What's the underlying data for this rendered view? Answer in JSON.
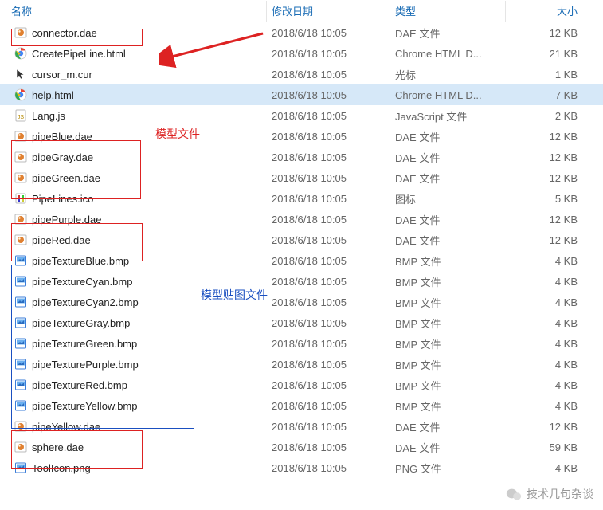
{
  "header": {
    "name": "名称",
    "date": "修改日期",
    "type": "类型",
    "size": "大小"
  },
  "rows": [
    {
      "icon": "dae",
      "name": "connector.dae",
      "date": "2018/6/18 10:05",
      "type": "DAE 文件",
      "size": "12 KB",
      "sel": false
    },
    {
      "icon": "chrome",
      "name": "CreatePipeLine.html",
      "date": "2018/6/18 10:05",
      "type": "Chrome HTML D...",
      "size": "21 KB",
      "sel": false
    },
    {
      "icon": "cur",
      "name": "cursor_m.cur",
      "date": "2018/6/18 10:05",
      "type": "光标",
      "size": "1 KB",
      "sel": false
    },
    {
      "icon": "chrome",
      "name": "help.html",
      "date": "2018/6/18 10:05",
      "type": "Chrome HTML D...",
      "size": "7 KB",
      "sel": true
    },
    {
      "icon": "js",
      "name": "Lang.js",
      "date": "2018/6/18 10:05",
      "type": "JavaScript 文件",
      "size": "2 KB",
      "sel": false
    },
    {
      "icon": "dae",
      "name": "pipeBlue.dae",
      "date": "2018/6/18 10:05",
      "type": "DAE 文件",
      "size": "12 KB",
      "sel": false
    },
    {
      "icon": "dae",
      "name": "pipeGray.dae",
      "date": "2018/6/18 10:05",
      "type": "DAE 文件",
      "size": "12 KB",
      "sel": false
    },
    {
      "icon": "dae",
      "name": "pipeGreen.dae",
      "date": "2018/6/18 10:05",
      "type": "DAE 文件",
      "size": "12 KB",
      "sel": false
    },
    {
      "icon": "ico",
      "name": "PipeLines.ico",
      "date": "2018/6/18 10:05",
      "type": "图标",
      "size": "5 KB",
      "sel": false
    },
    {
      "icon": "dae",
      "name": "pipePurple.dae",
      "date": "2018/6/18 10:05",
      "type": "DAE 文件",
      "size": "12 KB",
      "sel": false
    },
    {
      "icon": "dae",
      "name": "pipeRed.dae",
      "date": "2018/6/18 10:05",
      "type": "DAE 文件",
      "size": "12 KB",
      "sel": false
    },
    {
      "icon": "bmp",
      "name": "pipeTextureBlue.bmp",
      "date": "2018/6/18 10:05",
      "type": "BMP 文件",
      "size": "4 KB",
      "sel": false
    },
    {
      "icon": "bmp",
      "name": "pipeTextureCyan.bmp",
      "date": "2018/6/18 10:05",
      "type": "BMP 文件",
      "size": "4 KB",
      "sel": false
    },
    {
      "icon": "bmp",
      "name": "pipeTextureCyan2.bmp",
      "date": "2018/6/18 10:05",
      "type": "BMP 文件",
      "size": "4 KB",
      "sel": false
    },
    {
      "icon": "bmp",
      "name": "pipeTextureGray.bmp",
      "date": "2018/6/18 10:05",
      "type": "BMP 文件",
      "size": "4 KB",
      "sel": false
    },
    {
      "icon": "bmp",
      "name": "pipeTextureGreen.bmp",
      "date": "2018/6/18 10:05",
      "type": "BMP 文件",
      "size": "4 KB",
      "sel": false
    },
    {
      "icon": "bmp",
      "name": "pipeTexturePurple.bmp",
      "date": "2018/6/18 10:05",
      "type": "BMP 文件",
      "size": "4 KB",
      "sel": false
    },
    {
      "icon": "bmp",
      "name": "pipeTextureRed.bmp",
      "date": "2018/6/18 10:05",
      "type": "BMP 文件",
      "size": "4 KB",
      "sel": false
    },
    {
      "icon": "bmp",
      "name": "pipeTextureYellow.bmp",
      "date": "2018/6/18 10:05",
      "type": "BMP 文件",
      "size": "4 KB",
      "sel": false
    },
    {
      "icon": "dae",
      "name": "pipeYellow.dae",
      "date": "2018/6/18 10:05",
      "type": "DAE 文件",
      "size": "12 KB",
      "sel": false
    },
    {
      "icon": "dae",
      "name": "sphere.dae",
      "date": "2018/6/18 10:05",
      "type": "DAE 文件",
      "size": "59 KB",
      "sel": false
    },
    {
      "icon": "png",
      "name": "ToolIcon.png",
      "date": "2018/6/18 10:05",
      "type": "PNG 文件",
      "size": "4 KB",
      "sel": false
    }
  ],
  "annotations": {
    "model_files": "模型文件",
    "texture_files": "模型贴图文件"
  },
  "watermark": "技术几句杂谈"
}
